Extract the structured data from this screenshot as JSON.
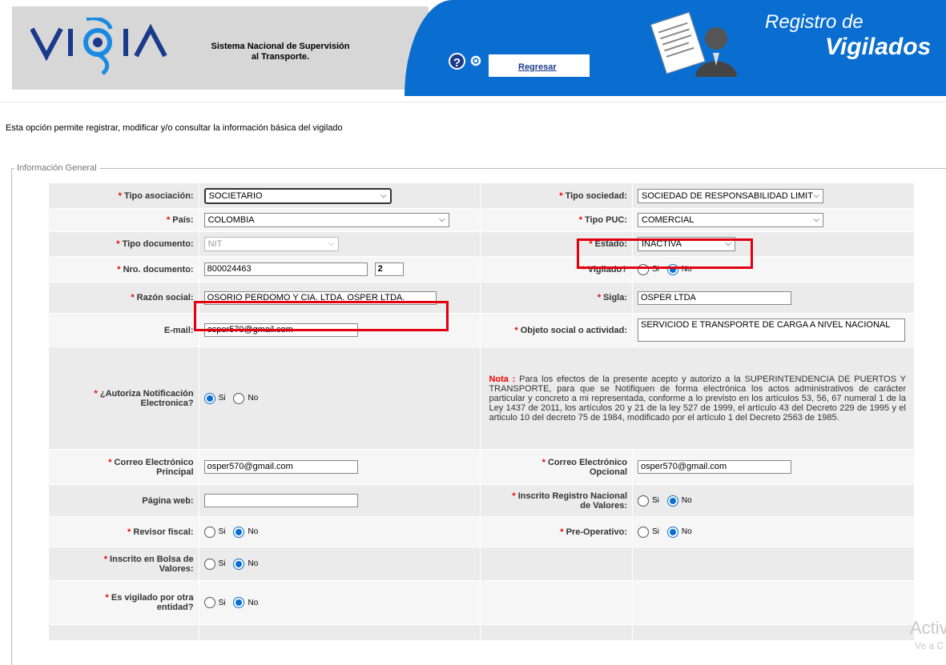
{
  "header": {
    "logo_text": "VIGIA",
    "subtitle_line1": "Sistema Nacional de Supervisión",
    "subtitle_line2": "al Transporte.",
    "help_symbol": "?",
    "back_link": "Regresar",
    "title_line1": "Registro de",
    "title_line2": "Vigilados",
    "colors": {
      "blue": "#0a6ed1",
      "grey": "#d7d7d7",
      "required": "#e00010"
    }
  },
  "intro": "Esta opción permite registrar, modificar y/o consultar la información básica del vigilado",
  "section_legend": "Información General",
  "required_mark": "*",
  "fields": {
    "tipo_asociacion": {
      "label": "Tipo asociación:",
      "value": "SOCIETARIO"
    },
    "tipo_sociedad": {
      "label": "Tipo sociedad:",
      "value": "SOCIEDAD DE RESPONSABILIDAD LIMIT"
    },
    "pais": {
      "label": "País:",
      "value": "COLOMBIA"
    },
    "tipo_puc": {
      "label": "Tipo PUC:",
      "value": "COMERCIAL"
    },
    "tipo_documento": {
      "label": "Tipo documento:",
      "value": "NIT"
    },
    "estado": {
      "label": "Estado:",
      "value": "INACTIVA"
    },
    "nro_documento": {
      "label": "Nro. documento:",
      "value": "800024463",
      "dv": "2"
    },
    "vigilado": {
      "label": "Vigilado?",
      "selected": "No"
    },
    "razon_social": {
      "label": "Razón social:",
      "value": "OSORIO PERDOMO Y CIA. LTDA. OSPER LTDA."
    },
    "sigla": {
      "label": "Sigla:",
      "value": "OSPER LTDA"
    },
    "email": {
      "label": "E-mail:",
      "value": "osper570@gmail.com"
    },
    "objeto_social": {
      "label": "Objeto social o actividad:",
      "value": "SERVICIOD E TRANSPORTE DE CARGA A NIVEL NACIONAL"
    },
    "autoriza_line1": "¿Autoriza Notificación",
    "autoriza_line2": "Electronica?",
    "autoriza_selected": "Si",
    "correo_principal_line1": "Correo Electrónico",
    "correo_principal_line2": "Principal",
    "correo_principal_value": "osper570@gmail.com",
    "correo_opcional_line1": "Correo Electrónico",
    "correo_opcional_line2": "Opcional",
    "correo_opcional_value": "osper570@gmail.com",
    "pagina_web": {
      "label": "Página web:",
      "value": ""
    },
    "registro_valores_line1": "Inscrito Registro Nacional",
    "registro_valores_line2": "de Valores:",
    "revisor_fiscal": {
      "label": "Revisor fiscal:"
    },
    "pre_operativo": {
      "label": "Pre-Operativo:"
    },
    "bolsa_line1": "Inscrito en Bolsa de",
    "bolsa_line2": "Valores:",
    "otra_entidad_line1": "Es vigilado por otra",
    "otra_entidad_line2": "entidad?"
  },
  "radio": {
    "si": "Si",
    "no": "No"
  },
  "nota": {
    "title": "Nota :",
    "text": "Para los efectos de la presente acepto y autorizo a la SUPERINTENDENCIA DE PUERTOS Y TRANSPORTE, para que se Notifiquen de forma electrónica los actos administrativos de carácter particular y concreto a mi representada, conforme a lo previsto en los artículos 53, 56, 67 numeral 1 de la Ley 1437 de 2011, los artículos 20 y 21 de la ley 527 de 1999, el artículo 43 del Decreto 229 de 1995 y el articulo 10 del decreto 75 de 1984, modificado por el artículo 1 del Decreto 2563 de 1985."
  },
  "watermark": {
    "line1": "Activ",
    "line2": "Ve a C"
  }
}
